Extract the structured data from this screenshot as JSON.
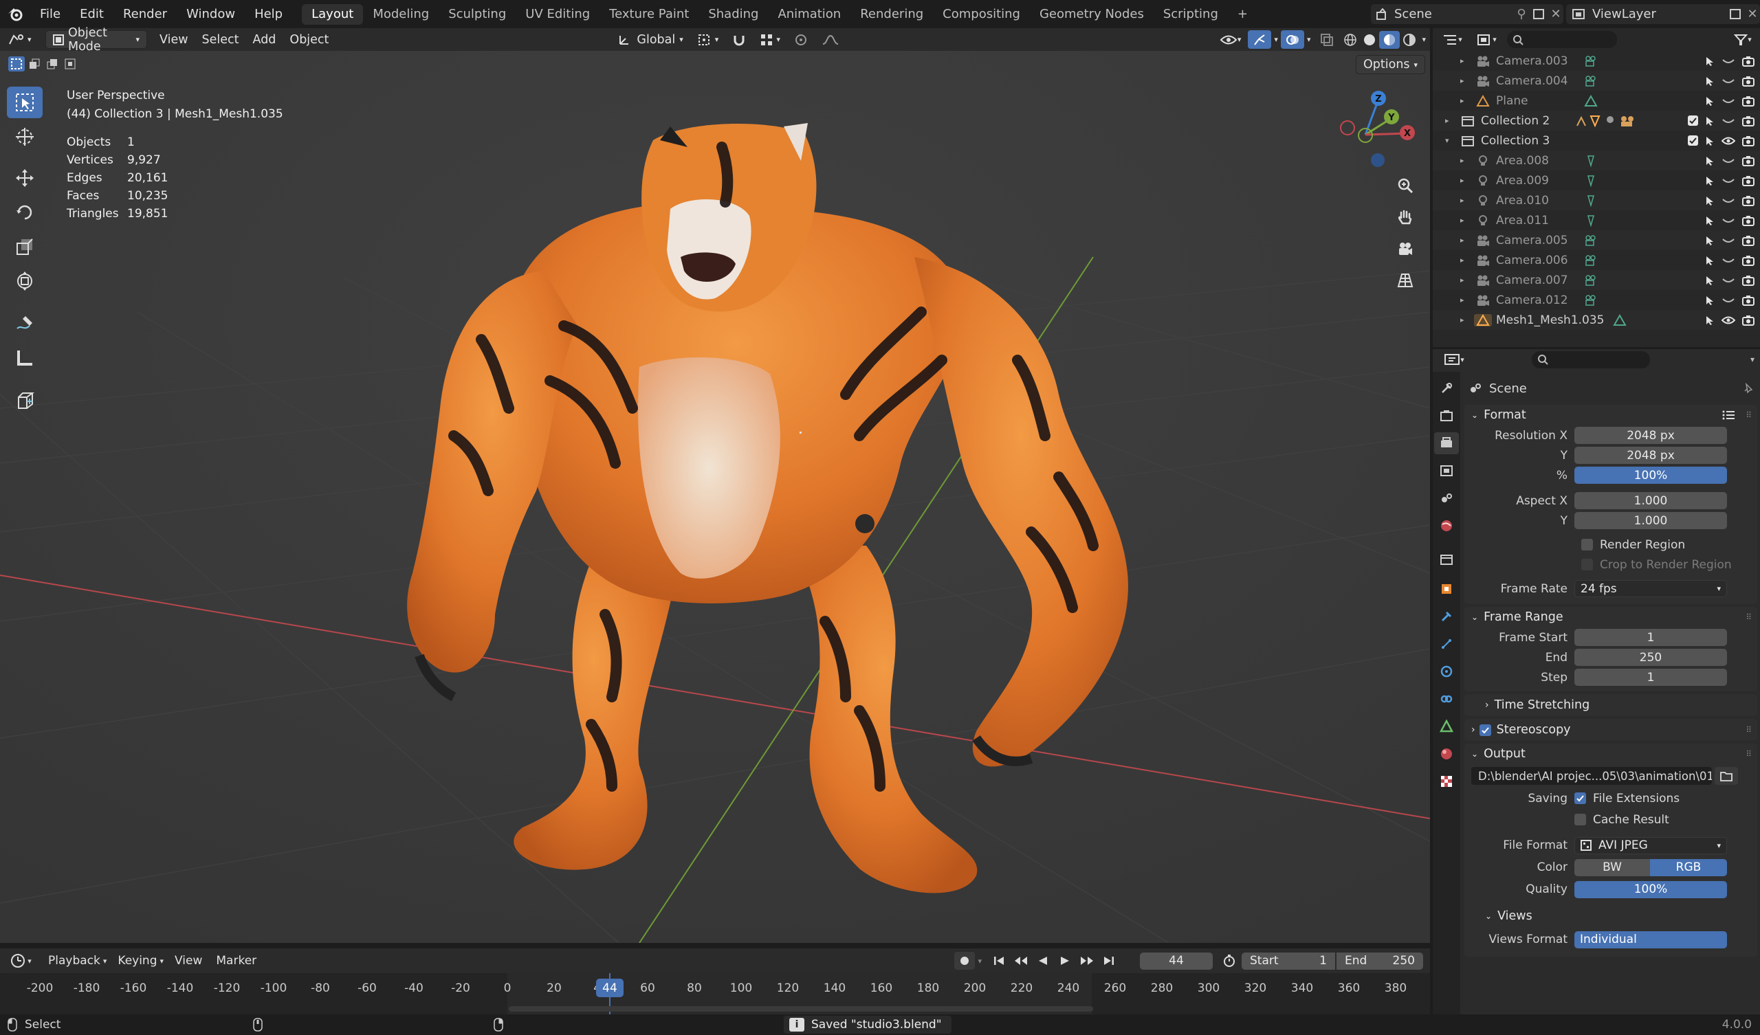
{
  "topbar": {
    "menus": [
      "File",
      "Edit",
      "Render",
      "Window",
      "Help"
    ],
    "workspaces": [
      "Layout",
      "Modeling",
      "Sculpting",
      "UV Editing",
      "Texture Paint",
      "Shading",
      "Animation",
      "Rendering",
      "Compositing",
      "Geometry Nodes",
      "Scripting"
    ],
    "active_workspace": "Layout",
    "add_tab": "+",
    "scene_name": "Scene",
    "view_layer": "ViewLayer"
  },
  "viewport_header": {
    "mode": "Object Mode",
    "menus": [
      "View",
      "Select",
      "Add",
      "Object"
    ],
    "transform_orientation": "Global",
    "options_label": "Options"
  },
  "viewport": {
    "perspective": "User Perspective",
    "collection_info": "(44) Collection 3 | Mesh1_Mesh1.035",
    "stats": [
      {
        "label": "Objects",
        "value": "1"
      },
      {
        "label": "Vertices",
        "value": "9,927"
      },
      {
        "label": "Edges",
        "value": "20,161"
      },
      {
        "label": "Faces",
        "value": "10,235"
      },
      {
        "label": "Triangles",
        "value": "19,851"
      }
    ],
    "gizmo": {
      "z": "Z",
      "y": "Y",
      "x": "X"
    }
  },
  "outliner": {
    "rows": [
      {
        "name": "Camera.003",
        "type": "camera",
        "dim": true
      },
      {
        "name": "Camera.004",
        "type": "camera",
        "dim": true
      },
      {
        "name": "Plane",
        "type": "mesh",
        "dim": true
      },
      {
        "name": "Collection 2",
        "type": "collection",
        "dim": false,
        "badge": "2"
      },
      {
        "name": "Collection 3",
        "type": "collection",
        "dim": false
      },
      {
        "name": "Area.008",
        "type": "light",
        "dim": true
      },
      {
        "name": "Area.009",
        "type": "light",
        "dim": true
      },
      {
        "name": "Area.010",
        "type": "light",
        "dim": true
      },
      {
        "name": "Area.011",
        "type": "light",
        "dim": true
      },
      {
        "name": "Camera.005",
        "type": "camera",
        "dim": true
      },
      {
        "name": "Camera.006",
        "type": "camera",
        "dim": true
      },
      {
        "name": "Camera.007",
        "type": "camera",
        "dim": true
      },
      {
        "name": "Camera.012",
        "type": "camera",
        "dim": true
      },
      {
        "name": "Mesh1_Mesh1.035",
        "type": "mesh",
        "dim": false
      }
    ]
  },
  "properties": {
    "context": "Scene",
    "format": {
      "title": "Format",
      "resolution_x_label": "Resolution X",
      "resolution_x": "2048 px",
      "resolution_y_label": "Y",
      "resolution_y": "2048 px",
      "percent_label": "%",
      "percent": "100%",
      "aspect_x_label": "Aspect X",
      "aspect_x": "1.000",
      "aspect_y_label": "Y",
      "aspect_y": "1.000",
      "render_region": "Render Region",
      "crop_region": "Crop to Render Region",
      "frame_rate_label": "Frame Rate",
      "frame_rate": "24 fps"
    },
    "frame_range": {
      "title": "Frame Range",
      "start_label": "Frame Start",
      "start": "1",
      "end_label": "End",
      "end": "250",
      "step_label": "Step",
      "step": "1"
    },
    "time_stretching": "Time Stretching",
    "stereoscopy": "Stereoscopy",
    "output": {
      "title": "Output",
      "path": "D:\\blender\\AI projec...05\\03\\animation\\01",
      "saving_label": "Saving",
      "file_extensions": "File Extensions",
      "cache_result": "Cache Result",
      "file_format_label": "File Format",
      "file_format": "AVI JPEG",
      "color_label": "Color",
      "color_bw": "BW",
      "color_rgb": "RGB",
      "quality_label": "Quality",
      "quality": "100%"
    },
    "views": {
      "title": "Views",
      "format_label": "Views Format",
      "format": "Individual"
    }
  },
  "timeline": {
    "menus": [
      "Playback",
      "Keying",
      "View",
      "Marker"
    ],
    "current_frame": "44",
    "start_label": "Start",
    "start": "1",
    "end_label": "End",
    "end": "250",
    "ruler": [
      "-200",
      "-180",
      "-160",
      "-140",
      "-120",
      "-100",
      "-80",
      "-60",
      "-40",
      "-20",
      "0",
      "20",
      "40",
      "60",
      "80",
      "100",
      "120",
      "140",
      "160",
      "180",
      "200",
      "220",
      "240",
      "260",
      "280",
      "300",
      "320",
      "340",
      "360",
      "380"
    ],
    "playhead": "44"
  },
  "statusbar": {
    "left": "Select",
    "message": "Saved \"studio3.blend\"",
    "version": "4.0.0"
  },
  "colors": {
    "accent": "#4772b3",
    "x_axis": "#c2474f",
    "y_axis": "#7ea83c",
    "z_axis": "#3b80d6",
    "tiger_orange": "#e07a26"
  }
}
